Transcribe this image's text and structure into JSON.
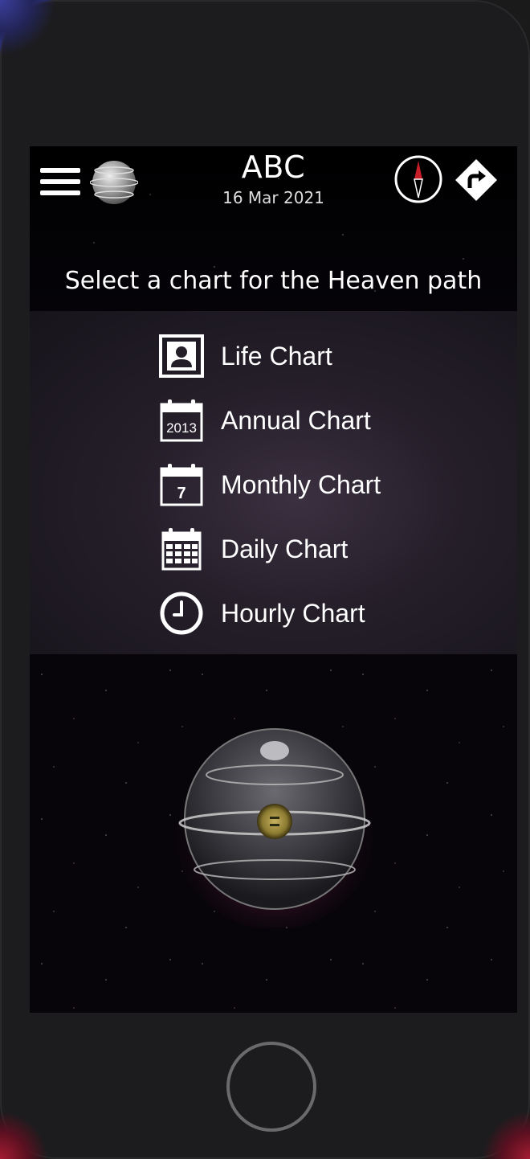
{
  "header": {
    "title": "ABC",
    "date": "16 Mar 2021",
    "subtitle": "Select a chart for the Heaven path"
  },
  "menu": {
    "items": [
      {
        "label": "Life Chart",
        "icon": "person-card-icon"
      },
      {
        "label": "Annual Chart",
        "icon": "calendar-year-icon",
        "icon_text": "2013"
      },
      {
        "label": "Monthly Chart",
        "icon": "calendar-month-icon",
        "icon_text": "7"
      },
      {
        "label": "Daily Chart",
        "icon": "calendar-grid-icon"
      },
      {
        "label": "Hourly Chart",
        "icon": "clock-icon"
      }
    ]
  },
  "colors": {
    "accent_red": "#c81e28",
    "text": "#ffffff",
    "screen_bg": "#050308",
    "panel_bg": "#241e29"
  }
}
